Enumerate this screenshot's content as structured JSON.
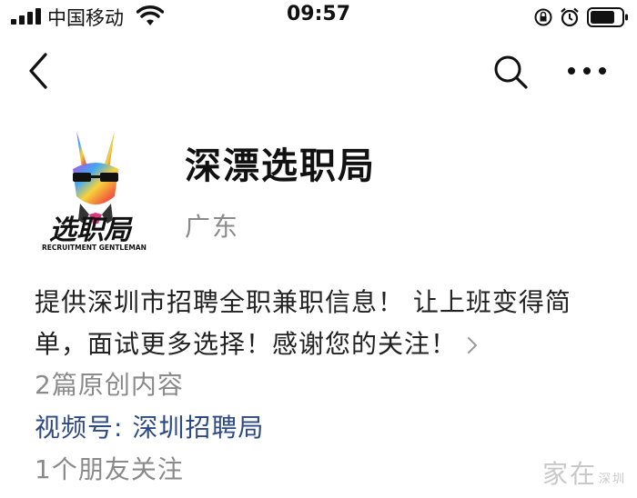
{
  "status_bar": {
    "carrier": "中国移动",
    "time": "09:57",
    "icons": [
      "signal-icon",
      "wifi-icon",
      "rotation-lock-icon",
      "alarm-icon",
      "battery-icon"
    ]
  },
  "nav": {
    "icons": [
      "back-icon",
      "search-icon",
      "more-icon"
    ]
  },
  "profile": {
    "logo_text": "选职局",
    "logo_subtext": "RECRUITMENT GENTLEMAN",
    "name": "深漂选职局",
    "region": "广东",
    "description": "提供深圳市招聘全职兼职信息！ 让上班变得简单，面试更多选择！感谢您的关注！",
    "articles": "2篇原创内容",
    "channels": "视频号: 深圳招聘局",
    "friends": "1个朋友关注"
  },
  "watermark": {
    "text": "家在",
    "small": "深圳"
  }
}
